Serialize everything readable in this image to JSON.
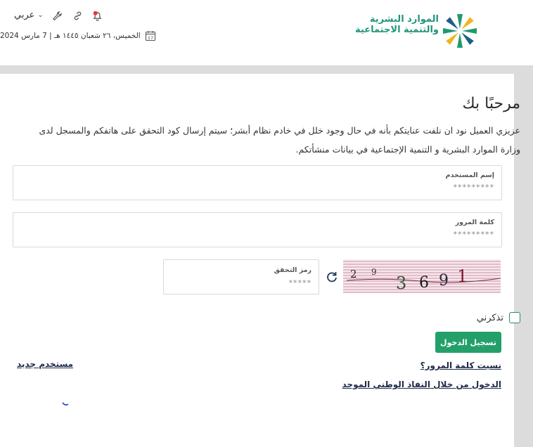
{
  "header": {
    "language_label": "عربي",
    "date_text": "الخميس، ٢٦ شعبان ١٤٤٥ هـ | 7 مارس 2024",
    "calendar_day": "17",
    "logo_line1": "الموارد البشرية",
    "logo_line2": "والتنمية الاجتماعية"
  },
  "main": {
    "title": "مرحبًا بك",
    "intro": "عزيزي العميل نود ان نلفت عنايتكم بأنه في حال وجود خلل في خادم نظام أبشر؛ سيتم إرسال كود التحقق على هاتفكم والمسجل لدى وزارة الموارد البشرية و التنمية الإجتماعية في بيانات منشأتكم.",
    "username": {
      "label": "إسم المستخدم",
      "placeholder": "*********"
    },
    "password": {
      "label": "كلمة المرور",
      "placeholder": "*********"
    },
    "captcha": {
      "label": "رمز التحقق",
      "placeholder": "*****",
      "image_text": [
        "2",
        "9",
        "3",
        "6",
        "9",
        "1"
      ]
    },
    "remember_label": "تذكرني",
    "login_button": "تسجيل الدخول",
    "forgot_password": "نسيت كلمة المرور؟",
    "nafath_login": "الدخول من خلال النفاذ الوطني الموحد",
    "new_user": "مستخدم جديد"
  },
  "colors": {
    "brand_green": "#23a06a",
    "logo_green": "#22957a",
    "link_navy": "#1e2a4a",
    "notification_red": "#e53935"
  }
}
